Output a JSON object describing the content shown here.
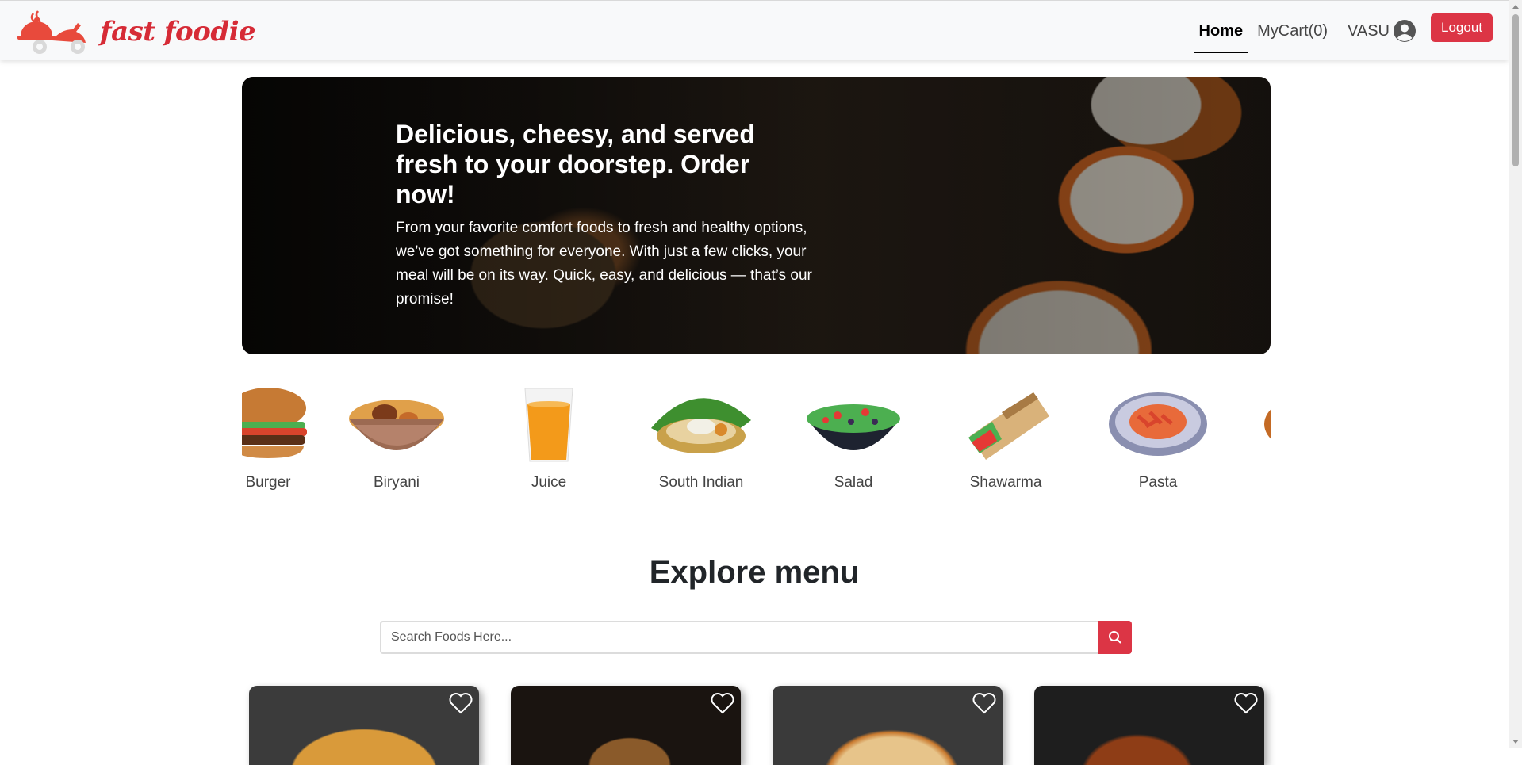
{
  "brand": {
    "name": "fast foodie",
    "accent": "#dc3545"
  },
  "nav": {
    "home": "Home",
    "cart": "MyCart(0)",
    "user": "VASU",
    "user_icon": "user-circle-icon",
    "logout": "Logout"
  },
  "hero": {
    "title": "Delicious, cheesy, and served fresh to your doorstep. Order now!",
    "text": "From your favorite comfort foods to fresh and healthy options, we’ve got something for everyone. With just a few clicks, your meal will be on its way. Quick, easy, and delicious — that’s our promise!"
  },
  "categories": [
    {
      "label": "Burger",
      "icon": "burger-icon"
    },
    {
      "label": "Biryani",
      "icon": "biryani-icon"
    },
    {
      "label": "Juice",
      "icon": "juice-icon"
    },
    {
      "label": "South Indian",
      "icon": "south-indian-icon"
    },
    {
      "label": "Salad",
      "icon": "salad-icon"
    },
    {
      "label": "Shawarma",
      "icon": "shawarma-icon"
    },
    {
      "label": "Pasta",
      "icon": "pasta-icon"
    }
  ],
  "explore": {
    "title": "Explore menu",
    "search_placeholder": "Search Foods Here...",
    "search_icon": "search-icon"
  },
  "food_cards": [
    {
      "image": "pizza-image",
      "favorite_icon": "heart-icon"
    },
    {
      "image": "chicken-dish-image",
      "favorite_icon": "heart-icon"
    },
    {
      "image": "margherita-pizza-image",
      "favorite_icon": "heart-icon"
    },
    {
      "image": "roast-chicken-image",
      "favorite_icon": "heart-icon"
    }
  ]
}
